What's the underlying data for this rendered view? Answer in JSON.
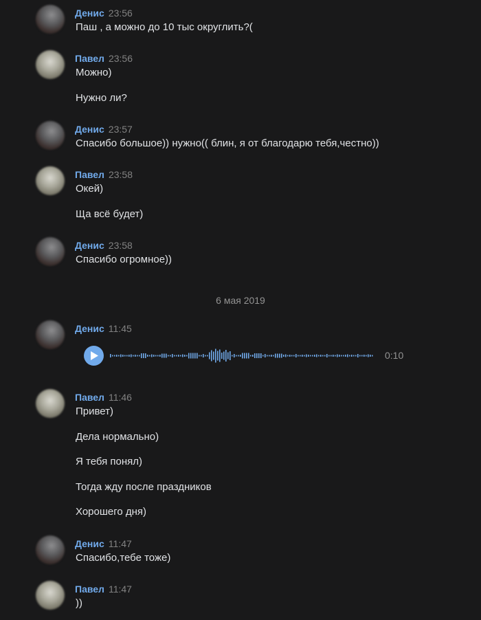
{
  "messages": [
    {
      "author": "Денис",
      "time": "23:56",
      "lines": [
        "Паш , а можно до 10 тыс округлить?("
      ]
    },
    {
      "author": "Павел",
      "time": "23:56",
      "lines": [
        "Можно)",
        "Нужно ли?"
      ]
    },
    {
      "author": "Денис",
      "time": "23:57",
      "lines": [
        "Спасибо большое)) нужно(( блин, я от благодарю тебя,честно))"
      ]
    },
    {
      "author": "Павел",
      "time": "23:58",
      "lines": [
        "Окей)",
        "Ща всё будет)"
      ]
    },
    {
      "author": "Денис",
      "time": "23:58",
      "lines": [
        "Спасибо огромное))"
      ]
    }
  ],
  "date_separator": "6 мая 2019",
  "voice_message": {
    "author": "Денис",
    "time": "11:45",
    "duration": "0:10"
  },
  "messages_after": [
    {
      "author": "Павел",
      "time": "11:46",
      "lines": [
        "Привет)",
        "Дела нормально)",
        "Я тебя понял)",
        "Тогда жду после праздников",
        "Хорошего дня)"
      ]
    },
    {
      "author": "Денис",
      "time": "11:47",
      "lines": [
        "Спасибо,тебе тоже)"
      ]
    },
    {
      "author": "Павел",
      "time": "11:47",
      "lines": [
        "))"
      ]
    }
  ],
  "colors": {
    "background": "#19191a",
    "author_name": "#71aaeb",
    "time": "#828282",
    "text": "#e1e3e6",
    "waveform": "#71aaeb"
  }
}
